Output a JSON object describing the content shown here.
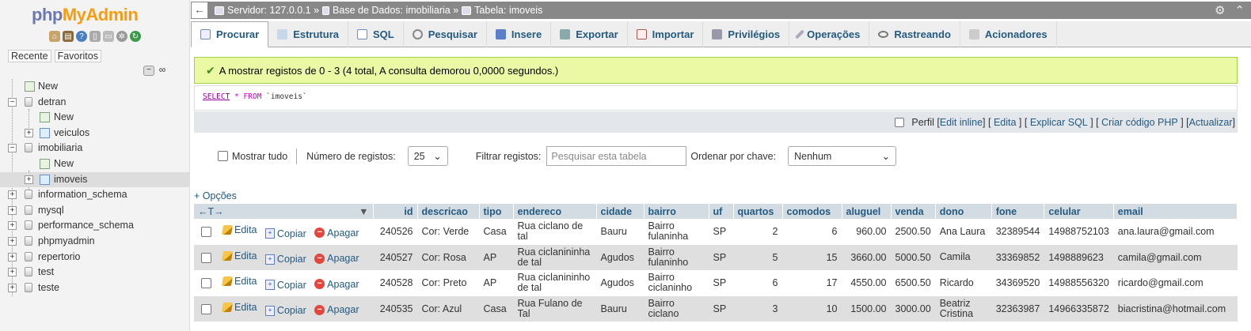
{
  "logo": {
    "php": "php",
    "ma": "MyAdmin"
  },
  "nav": {
    "tabs": [
      "Recente",
      "Favoritos"
    ],
    "collapse_label": "−",
    "link_label": "∞",
    "tree": [
      {
        "label": "New",
        "level": 1,
        "icon": "new-icon"
      },
      {
        "label": "detran",
        "level": 0,
        "icon": "database-icon",
        "expanded": true
      },
      {
        "label": "New",
        "level": 2,
        "icon": "new-icon"
      },
      {
        "label": "veiculos",
        "level": 2,
        "icon": "table-icon"
      },
      {
        "label": "imobiliaria",
        "level": 0,
        "icon": "database-icon",
        "expanded": true
      },
      {
        "label": "New",
        "level": 2,
        "icon": "new-icon"
      },
      {
        "label": "imoveis",
        "level": 2,
        "icon": "table-icon",
        "selected": true
      },
      {
        "label": "information_schema",
        "level": 0,
        "icon": "database-icon"
      },
      {
        "label": "mysql",
        "level": 0,
        "icon": "database-icon"
      },
      {
        "label": "performance_schema",
        "level": 0,
        "icon": "database-icon"
      },
      {
        "label": "phpmyadmin",
        "level": 0,
        "icon": "database-icon"
      },
      {
        "label": "repertorio",
        "level": 0,
        "icon": "database-icon"
      },
      {
        "label": "test",
        "level": 0,
        "icon": "database-icon"
      },
      {
        "label": "teste",
        "level": 0,
        "icon": "database-icon"
      }
    ]
  },
  "breadcrumb": {
    "server": "Servidor: 127.0.0.1 »",
    "database": "Base de Dados: imobiliaria »",
    "table": "Tabela: imoveis"
  },
  "tabs": [
    {
      "label": "Procurar",
      "icon": "browse-icon",
      "active": true
    },
    {
      "label": "Estrutura",
      "icon": "structure-icon"
    },
    {
      "label": "SQL",
      "icon": "sql-icon"
    },
    {
      "label": "Pesquisar",
      "icon": "search-icon"
    },
    {
      "label": "Insere",
      "icon": "insert-icon"
    },
    {
      "label": "Exportar",
      "icon": "export-icon"
    },
    {
      "label": "Importar",
      "icon": "import-icon"
    },
    {
      "label": "Privilégios",
      "icon": "privileges-icon"
    },
    {
      "label": "Operações",
      "icon": "operations-icon"
    },
    {
      "label": "Rastreando",
      "icon": "tracking-icon"
    },
    {
      "label": "Acionadores",
      "icon": "triggers-icon"
    }
  ],
  "success_message": "A mostrar registos de 0 - 3 (4 total, A consulta demorou 0,0000 segundos.)",
  "sql": {
    "select": "SELECT",
    "star": "*",
    "from": "FROM",
    "table": "`imoveis`"
  },
  "tools": {
    "perfil": "Perfil",
    "edit_inline": "Edit inline",
    "edita": "Edita",
    "explicar": "Explicar SQL",
    "criar": "Criar código PHP",
    "atualizar": "Actualizar"
  },
  "controls": {
    "mostrar_tudo": "Mostrar tudo",
    "num_registos_label": "Número de registos:",
    "num_registos_value": "25",
    "filtrar_label": "Filtrar registos:",
    "filtrar_placeholder": "Pesquisar esta tabela",
    "ordenar_label": "Ordenar por chave:",
    "ordenar_value": "Nenhum"
  },
  "opcoes": "+ Opções",
  "table": {
    "arrows": "←T→",
    "columns": [
      "id",
      "descricao",
      "tipo",
      "endereco",
      "cidade",
      "bairro",
      "uf",
      "quartos",
      "comodos",
      "aluguel",
      "venda",
      "dono",
      "fone",
      "celular",
      "email"
    ],
    "actions": {
      "edit": "Edita",
      "copy": "Copiar",
      "delete": "Apagar"
    },
    "rows": [
      [
        "240526",
        "Cor: Verde",
        "Casa",
        "Rua ciclano de tal",
        "Bauru",
        "Bairro fulaninha",
        "SP",
        "2",
        "6",
        "960.00",
        "2500.50",
        "Ana Laura",
        "32389544",
        "14988752103",
        "ana.laura@gmail.com"
      ],
      [
        "240527",
        "Cor: Rosa",
        "AP",
        "Rua ciclanininha de tal",
        "Agudos",
        "Bairro fulaninho",
        "SP",
        "5",
        "15",
        "3660.00",
        "5000.50",
        "Camila",
        "33369852",
        "1498889623",
        "camila@gmail.com"
      ],
      [
        "240528",
        "Cor: Preto",
        "AP",
        "Rua ciclanininho de tal",
        "Agudos",
        "Bairro ciclaninho",
        "SP",
        "6",
        "17",
        "4550.00",
        "6500.50",
        "Ricardo",
        "34369520",
        "14988556320",
        "ricardo@gmail.com"
      ],
      [
        "240535",
        "Cor: Azul",
        "Casa",
        "Rua Fulano de Tal",
        "Bauru",
        "Bairro ciclano",
        "SP",
        "3",
        "10",
        "1500.00",
        "3000.00",
        "Beatriz Cristina",
        "32363987",
        "14966335872",
        "biacristina@hotmail.com"
      ]
    ]
  }
}
